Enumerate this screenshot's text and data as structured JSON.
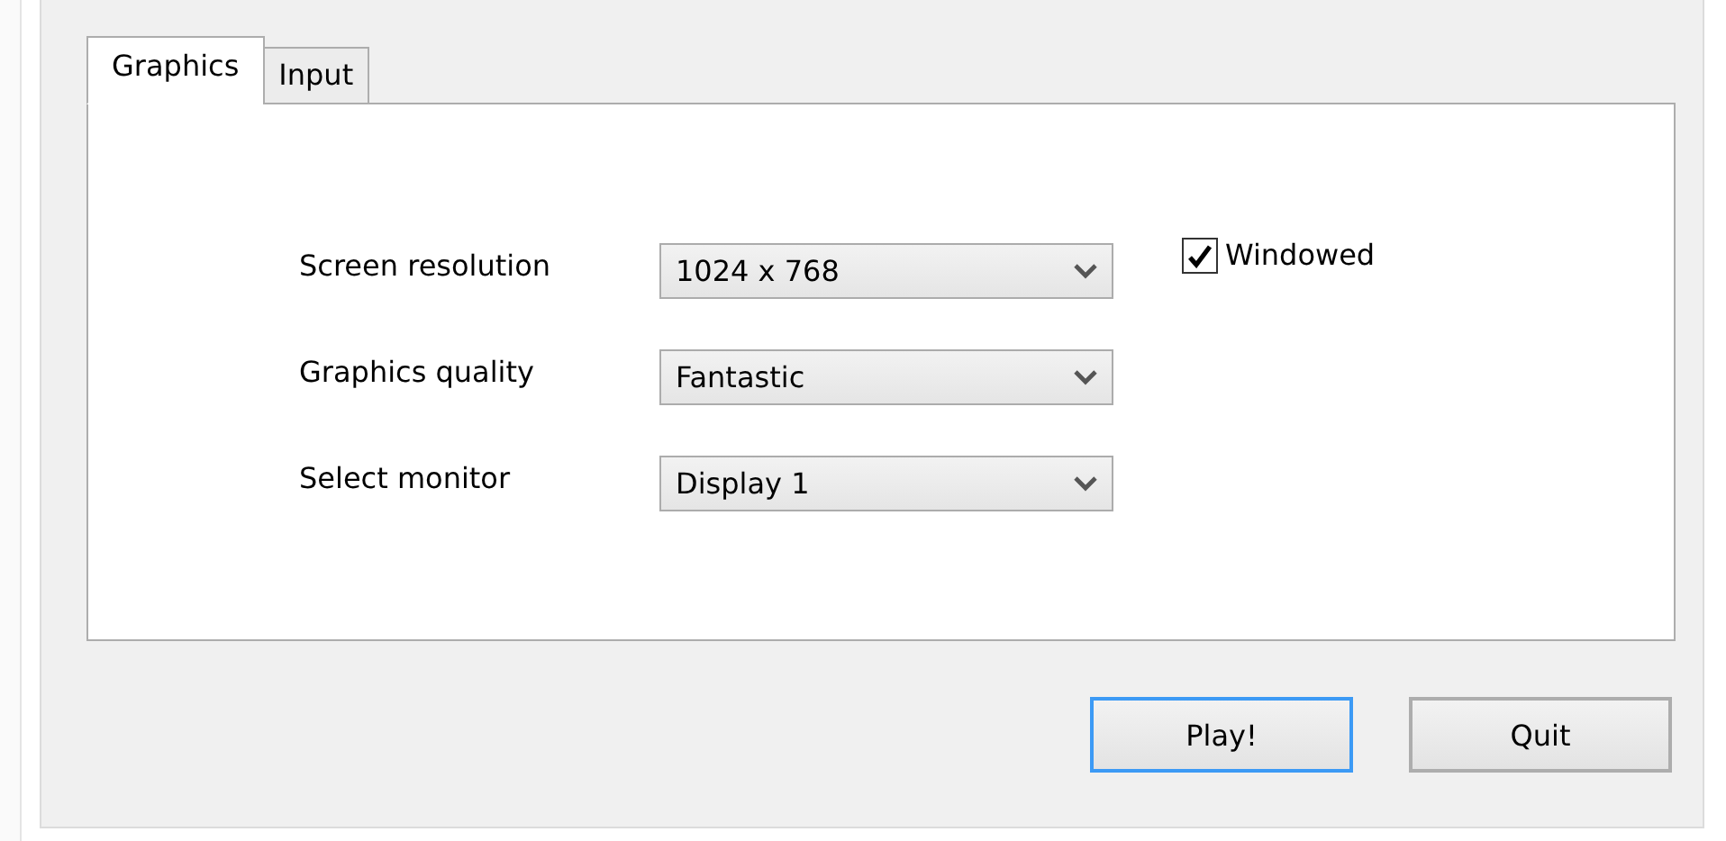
{
  "tabs": [
    {
      "label": "Graphics",
      "selected": true
    },
    {
      "label": "Input",
      "selected": false
    }
  ],
  "settings": [
    {
      "label": "Screen resolution",
      "value": "1024 x 768"
    },
    {
      "label": "Graphics quality",
      "value": "Fantastic"
    },
    {
      "label": "Select monitor",
      "value": "Display 1"
    }
  ],
  "windowed": {
    "label": "Windowed",
    "checked": true
  },
  "buttons": [
    {
      "label": "Play!",
      "focused": true
    },
    {
      "label": "Quit",
      "focused": false
    }
  ]
}
